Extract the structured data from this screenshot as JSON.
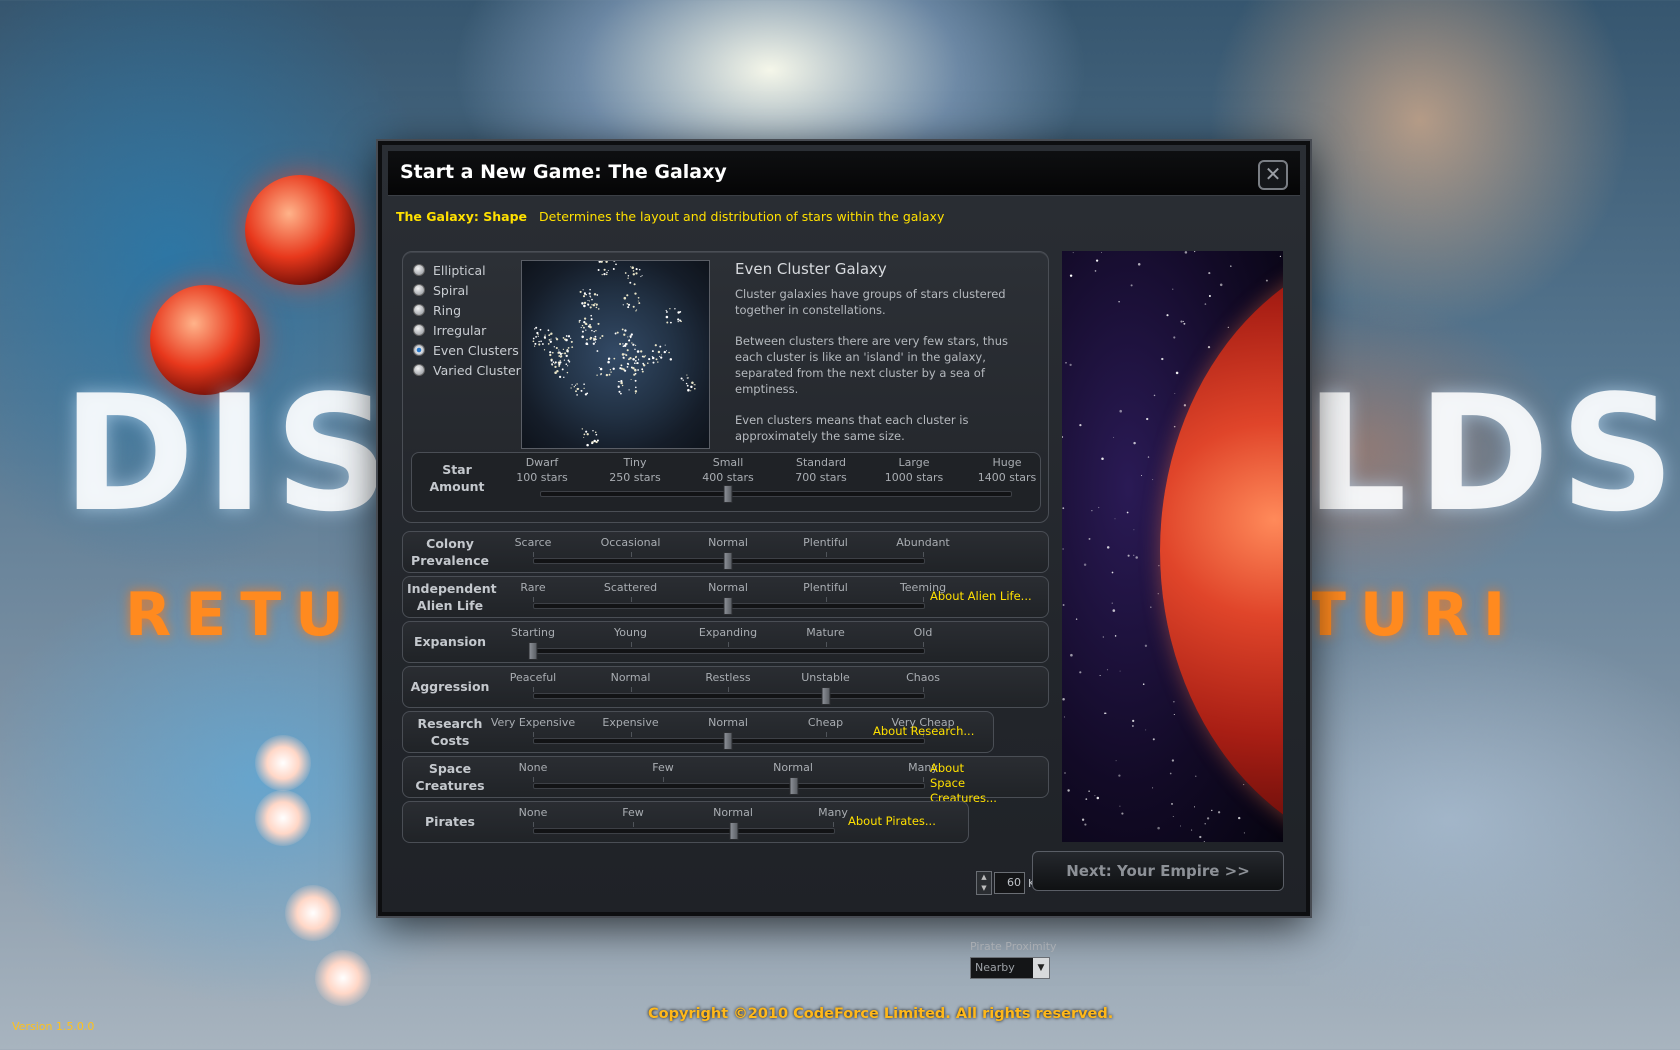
{
  "background": {
    "logo_left": "DIS",
    "logo_right": "LDS",
    "subtitle_left": "RETU",
    "subtitle_right": "TURI"
  },
  "dialog": {
    "title": "Start a New Game: The Galaxy",
    "close_label": "✕",
    "hint_label": "The Galaxy: Shape",
    "hint_text": "Determines the layout and distribution of stars within the galaxy",
    "shapes": [
      {
        "label": "Elliptical",
        "selected": false
      },
      {
        "label": "Spiral",
        "selected": false
      },
      {
        "label": "Ring",
        "selected": false
      },
      {
        "label": "Irregular",
        "selected": false
      },
      {
        "label": "Even Clusters",
        "selected": true
      },
      {
        "label": "Varied Clusters",
        "selected": false
      }
    ],
    "description": {
      "title": "Even Cluster Galaxy",
      "p1": "Cluster galaxies have groups of stars clustered together in constellations.",
      "p2": "Between clusters there are very few stars, thus each cluster is like an 'island' in the galaxy, separated from the next cluster by a sea of emptiness.",
      "p3": "Even clusters means that each cluster is approximately the same size."
    },
    "star_amount": {
      "label_line1": "Star",
      "label_line2": "Amount",
      "ticks": [
        {
          "name": "Dwarf",
          "stars": "100 stars"
        },
        {
          "name": "Tiny",
          "stars": "250 stars"
        },
        {
          "name": "Small",
          "stars": "400 stars"
        },
        {
          "name": "Standard",
          "stars": "700 stars"
        },
        {
          "name": "Large",
          "stars": "1000 stars"
        },
        {
          "name": "Huge",
          "stars": "1400 stars"
        }
      ],
      "value": 0.4
    },
    "sliders": [
      {
        "label1": "Colony",
        "label2": "Prevalence",
        "ticks": [
          "Scarce",
          "Occasional",
          "Normal",
          "Plentiful",
          "Abundant"
        ],
        "value": 0.5
      },
      {
        "label1": "Independent",
        "label2": "Alien Life",
        "ticks": [
          "Rare",
          "Scattered",
          "Normal",
          "Plentiful",
          "Teeming"
        ],
        "value": 0.5,
        "link": "About Alien Life..."
      },
      {
        "label1": "Expansion",
        "label2": "",
        "ticks": [
          "Starting",
          "Young",
          "Expanding",
          "Mature",
          "Old"
        ],
        "value": 0.0
      },
      {
        "label1": "Aggression",
        "label2": "",
        "ticks": [
          "Peaceful",
          "Normal",
          "Restless",
          "Unstable",
          "Chaos"
        ],
        "value": 0.75
      },
      {
        "label1": "Research",
        "label2": "Costs",
        "ticks": [
          "Very Expensive",
          "Expensive",
          "Normal",
          "Cheap",
          "Very Cheap"
        ],
        "value": 0.5,
        "link": "About Research..."
      },
      {
        "label1": "Space",
        "label2": "Creatures",
        "ticks": [
          "None",
          "Few",
          "Normal",
          "Many"
        ],
        "value": 0.67,
        "link": "About Space Creatures..."
      },
      {
        "label1": "Pirates",
        "label2": "",
        "ticks": [
          "None",
          "Few",
          "Normal",
          "Many"
        ],
        "value": 0.67,
        "link": "About Pirates..."
      }
    ],
    "research_spinner": {
      "value": "60",
      "unit": "K"
    },
    "pirate_proximity": {
      "label": "Pirate Proximity",
      "value": "Nearby"
    },
    "next_button": "Next: Your Empire >>"
  },
  "footer": {
    "copyright": "Copyright ©2010 CodeForce Limited. All rights reserved.",
    "version": "Version 1.5.0.0"
  },
  "colors": {
    "accent_yellow": "#ffe000",
    "copyright_orange": "#ffb81a",
    "dialog_bg": "#23262b"
  }
}
